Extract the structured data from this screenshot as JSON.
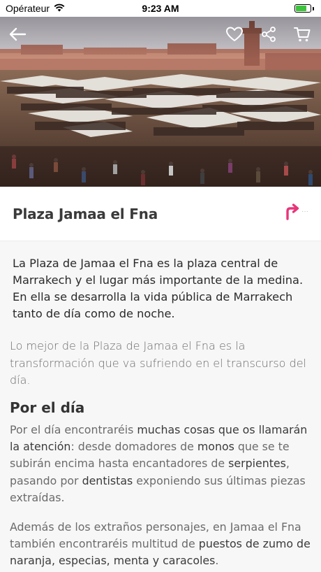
{
  "status_bar": {
    "carrier": "Opérateur",
    "time": "9:23 AM",
    "battery_level": 0.75
  },
  "header": {
    "back_icon": "arrow-left-icon",
    "favorite_icon": "heart-icon",
    "share_icon": "share-icon",
    "cart_icon": "cart-icon"
  },
  "place": {
    "title": "Plaza Jamaa el Fna",
    "directions_icon": "turn-right-arrow-icon",
    "accent_color": "#e8357a"
  },
  "article": {
    "lead": "La Plaza de Jamaa el Fna es la plaza central de Marrakech y el lugar más importante de la medina. En ella se desarrolla la vida pública de Marrakech tanto de día como de noche.",
    "intro": "Lo mejor de la Plaza de Jamaa el Fna es la transformación que va sufriendo en el transcurso del día.",
    "section_title": "Por el día",
    "para1": {
      "t1": "Por el día encontraréis ",
      "b1": "muchas cosas que os llamarán la atención",
      "t2": ": desde domadores de ",
      "b2": "monos",
      "t3": " que se te subirán encima hasta encantadores de ",
      "b3": "serpientes",
      "t4": ", pasando por ",
      "b4": "dentistas",
      "t5": " exponiendo sus últimas piezas extraídas."
    },
    "para2": {
      "t1": "Además de los extraños personajes, en Jamaa el Fna también encontraréis multitud de ",
      "b1": "puestos de zumo de naranja, especias, menta y caracoles",
      "t2": "."
    }
  }
}
